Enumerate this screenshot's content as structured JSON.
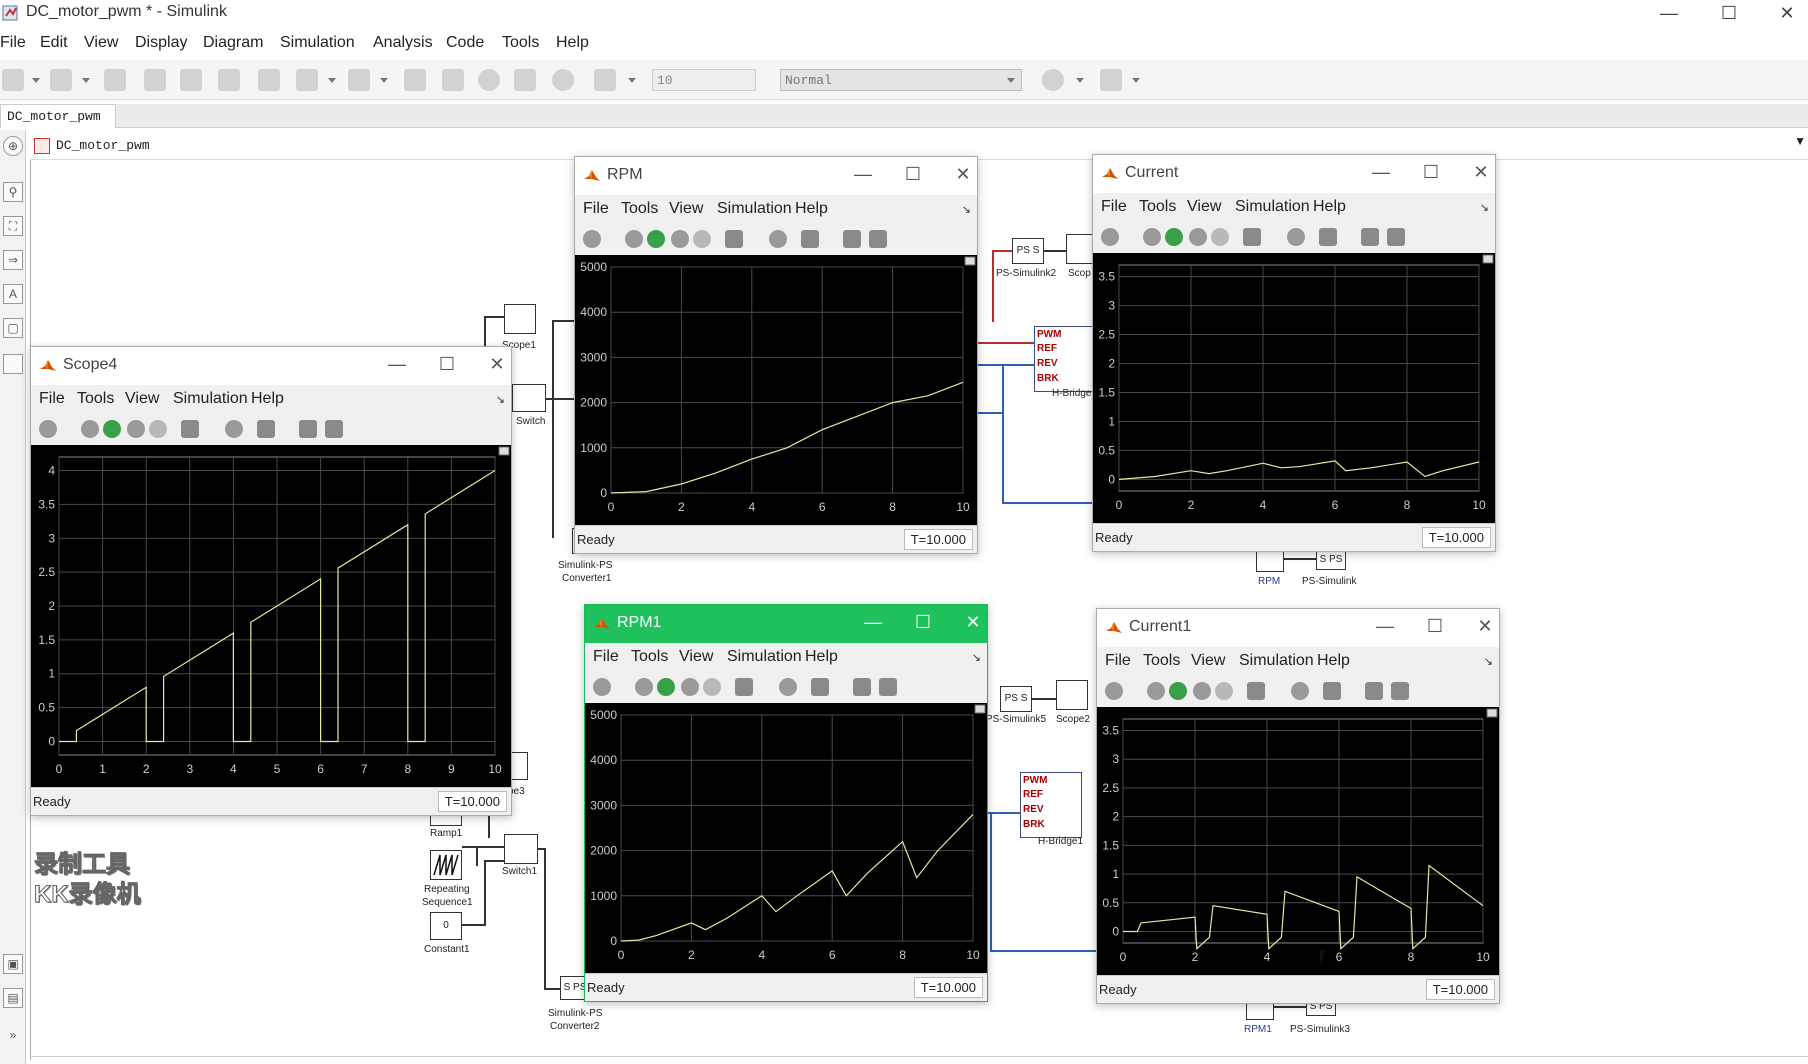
{
  "window": {
    "title": "DC_motor_pwm * - Simulink"
  },
  "menu": [
    "File",
    "Edit",
    "View",
    "Display",
    "Diagram",
    "Simulation",
    "Analysis",
    "Code",
    "Tools",
    "Help"
  ],
  "toolbar": {
    "stop_time": "10",
    "sim_mode": "Normal"
  },
  "tab": "DC_motor_pwm",
  "breadcrumb": "DC_motor_pwm",
  "watermark": {
    "line1": "录制工具",
    "line2": "KK录像机"
  },
  "blocks": {
    "scope1": "Scope1",
    "switch": "Switch",
    "simulink_ps1": "Simulink-PS",
    "simulink_ps1b": "Converter1",
    "ps_simulink2": "PS-Simulink2",
    "ps_simulink2_icon": "PS S",
    "scope_top": "Scop",
    "hbridge": "H-Bridge",
    "hbridge_ports": [
      "PWM",
      "REF",
      "REV",
      "BRK"
    ],
    "rpm_block": "RPM",
    "ps_simulink": "PS-Simulink",
    "ps_simulink_icon": "S PS",
    "ramp1": "Ramp1",
    "repeating1": "Repeating",
    "repeating1b": "Sequence1",
    "constant1": "Constant1",
    "constant1_value": "0",
    "switch1": "Switch1",
    "scope3": "pe3",
    "ps_simulink5": "PS-Simulink5",
    "ps_simulink5_icon": "PS S",
    "scope2": "Scope2",
    "hbridge1": "H-Bridge1",
    "hbridge1_ports": [
      "PWM",
      "REF",
      "REV",
      "BRK"
    ],
    "simulink_ps2": "Simulink-PS",
    "simulink_ps2b": "Converter2",
    "simulink_ps2_icon": "S PS",
    "rpm1_block": "RPM1",
    "ps_simulink3": "PS-Simulink3",
    "ps_simulink3_icon": "S PS"
  },
  "scope_menu": [
    "File",
    "Tools",
    "View",
    "Simulation",
    "Help"
  ],
  "colors": {
    "trace": "#e8e6a0",
    "grid": "#4a4a4a",
    "plot_bg": "#000000",
    "active_title": "#1ec15c"
  },
  "scopes": [
    {
      "key": "rpm",
      "title": "RPM",
      "status": "Ready",
      "time": "T=10.000"
    },
    {
      "key": "current",
      "title": "Current",
      "status": "Ready",
      "time": "T=10.000"
    },
    {
      "key": "scope4",
      "title": "Scope4",
      "status": "Ready",
      "time": "T=10.000"
    },
    {
      "key": "rpm1",
      "title": "RPM1",
      "status": "Ready",
      "time": "T=10.000"
    },
    {
      "key": "current1",
      "title": "Current1",
      "status": "Ready",
      "time": "T=10.000"
    }
  ],
  "chart_data": [
    {
      "type": "line",
      "title": "RPM",
      "xlim": [
        0,
        10
      ],
      "ylim": [
        0,
        5000
      ],
      "xticks": [
        0,
        2,
        4,
        6,
        8,
        10
      ],
      "yticks": [
        0,
        1000,
        2000,
        3000,
        4000,
        5000
      ],
      "grid": true,
      "x": [
        0,
        1,
        2,
        3,
        4,
        5,
        6,
        7,
        8,
        9,
        10
      ],
      "y": [
        0,
        30,
        200,
        450,
        750,
        1000,
        1400,
        1700,
        2000,
        2150,
        2450
      ]
    },
    {
      "type": "line",
      "title": "Current",
      "xlim": [
        0,
        10
      ],
      "ylim": [
        -0.2,
        3.7
      ],
      "xticks": [
        0,
        2,
        4,
        6,
        8,
        10
      ],
      "yticks": [
        0,
        0.5,
        1,
        1.5,
        2,
        2.5,
        3,
        3.5
      ],
      "grid": true,
      "x": [
        0,
        1,
        2,
        2.5,
        3,
        4,
        4.5,
        5,
        6,
        6.3,
        7,
        8,
        8.5,
        9,
        10
      ],
      "y": [
        0,
        0.05,
        0.15,
        0.1,
        0.15,
        0.28,
        0.2,
        0.22,
        0.32,
        0.15,
        0.2,
        0.3,
        0.05,
        0.15,
        0.3
      ]
    },
    {
      "type": "line",
      "title": "Scope4",
      "xlim": [
        0,
        10
      ],
      "ylim": [
        -0.2,
        4.2
      ],
      "xticks": [
        0,
        1,
        2,
        3,
        4,
        5,
        6,
        7,
        8,
        9,
        10
      ],
      "yticks": [
        0,
        0.5,
        1,
        1.5,
        2,
        2.5,
        3,
        3.5,
        4
      ],
      "grid": true,
      "x": [
        0,
        0.4,
        0.4,
        2,
        2,
        2.4,
        2.4,
        4,
        4,
        4.4,
        4.4,
        6,
        6,
        6.4,
        6.4,
        8,
        8,
        8.4,
        8.4,
        10
      ],
      "y": [
        0,
        0,
        0.16,
        0.8,
        0,
        0,
        0.96,
        1.6,
        0,
        0,
        1.76,
        2.4,
        0,
        0,
        2.56,
        3.2,
        0,
        0,
        3.36,
        4.0
      ]
    },
    {
      "type": "line",
      "title": "RPM1",
      "xlim": [
        0,
        10
      ],
      "ylim": [
        0,
        5000
      ],
      "xticks": [
        0,
        2,
        4,
        6,
        8,
        10
      ],
      "yticks": [
        0,
        1000,
        2000,
        3000,
        4000,
        5000
      ],
      "grid": true,
      "x": [
        0,
        0.5,
        1,
        2,
        2.4,
        3,
        4,
        4.4,
        5,
        6,
        6.4,
        7,
        8,
        8.4,
        9,
        10
      ],
      "y": [
        0,
        20,
        120,
        400,
        250,
        500,
        1000,
        650,
        1000,
        1550,
        1000,
        1500,
        2200,
        1400,
        2000,
        2800
      ]
    },
    {
      "type": "line",
      "title": "Current1",
      "xlim": [
        0,
        10
      ],
      "ylim": [
        -0.2,
        3.7
      ],
      "xticks": [
        0,
        2,
        4,
        6,
        8,
        10
      ],
      "yticks": [
        0,
        0.5,
        1,
        1.5,
        2,
        2.5,
        3,
        3.5
      ],
      "grid": true,
      "x": [
        0,
        0.4,
        0.5,
        2,
        2.05,
        2.4,
        2.5,
        4,
        4.05,
        4.4,
        4.5,
        6,
        6.05,
        6.4,
        6.5,
        8,
        8.05,
        8.4,
        8.5,
        10
      ],
      "y": [
        0,
        0,
        0.15,
        0.25,
        -0.3,
        -0.1,
        0.45,
        0.3,
        -0.3,
        -0.1,
        0.7,
        0.35,
        -0.3,
        -0.1,
        0.95,
        0.4,
        -0.3,
        -0.1,
        1.15,
        0.45
      ]
    }
  ]
}
